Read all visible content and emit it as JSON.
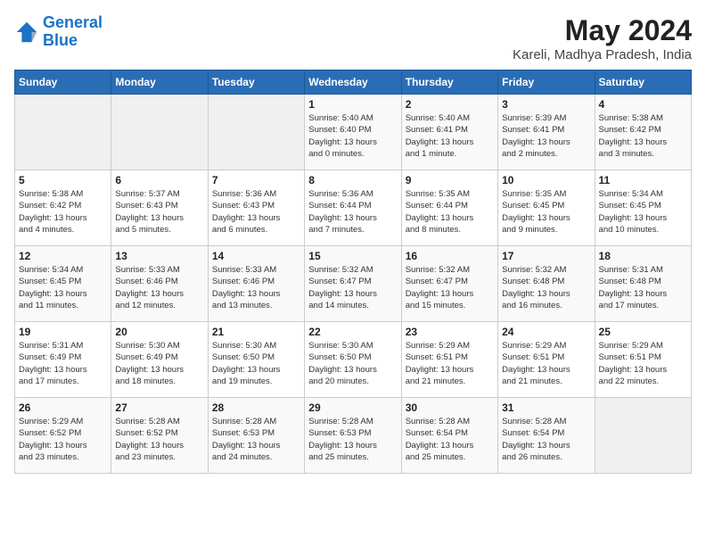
{
  "header": {
    "logo_line1": "General",
    "logo_line2": "Blue",
    "month_year": "May 2024",
    "location": "Kareli, Madhya Pradesh, India"
  },
  "days_of_week": [
    "Sunday",
    "Monday",
    "Tuesday",
    "Wednesday",
    "Thursday",
    "Friday",
    "Saturday"
  ],
  "weeks": [
    [
      {
        "day": "",
        "info": ""
      },
      {
        "day": "",
        "info": ""
      },
      {
        "day": "",
        "info": ""
      },
      {
        "day": "1",
        "info": "Sunrise: 5:40 AM\nSunset: 6:40 PM\nDaylight: 13 hours\nand 0 minutes."
      },
      {
        "day": "2",
        "info": "Sunrise: 5:40 AM\nSunset: 6:41 PM\nDaylight: 13 hours\nand 1 minute."
      },
      {
        "day": "3",
        "info": "Sunrise: 5:39 AM\nSunset: 6:41 PM\nDaylight: 13 hours\nand 2 minutes."
      },
      {
        "day": "4",
        "info": "Sunrise: 5:38 AM\nSunset: 6:42 PM\nDaylight: 13 hours\nand 3 minutes."
      }
    ],
    [
      {
        "day": "5",
        "info": "Sunrise: 5:38 AM\nSunset: 6:42 PM\nDaylight: 13 hours\nand 4 minutes."
      },
      {
        "day": "6",
        "info": "Sunrise: 5:37 AM\nSunset: 6:43 PM\nDaylight: 13 hours\nand 5 minutes."
      },
      {
        "day": "7",
        "info": "Sunrise: 5:36 AM\nSunset: 6:43 PM\nDaylight: 13 hours\nand 6 minutes."
      },
      {
        "day": "8",
        "info": "Sunrise: 5:36 AM\nSunset: 6:44 PM\nDaylight: 13 hours\nand 7 minutes."
      },
      {
        "day": "9",
        "info": "Sunrise: 5:35 AM\nSunset: 6:44 PM\nDaylight: 13 hours\nand 8 minutes."
      },
      {
        "day": "10",
        "info": "Sunrise: 5:35 AM\nSunset: 6:45 PM\nDaylight: 13 hours\nand 9 minutes."
      },
      {
        "day": "11",
        "info": "Sunrise: 5:34 AM\nSunset: 6:45 PM\nDaylight: 13 hours\nand 10 minutes."
      }
    ],
    [
      {
        "day": "12",
        "info": "Sunrise: 5:34 AM\nSunset: 6:45 PM\nDaylight: 13 hours\nand 11 minutes."
      },
      {
        "day": "13",
        "info": "Sunrise: 5:33 AM\nSunset: 6:46 PM\nDaylight: 13 hours\nand 12 minutes."
      },
      {
        "day": "14",
        "info": "Sunrise: 5:33 AM\nSunset: 6:46 PM\nDaylight: 13 hours\nand 13 minutes."
      },
      {
        "day": "15",
        "info": "Sunrise: 5:32 AM\nSunset: 6:47 PM\nDaylight: 13 hours\nand 14 minutes."
      },
      {
        "day": "16",
        "info": "Sunrise: 5:32 AM\nSunset: 6:47 PM\nDaylight: 13 hours\nand 15 minutes."
      },
      {
        "day": "17",
        "info": "Sunrise: 5:32 AM\nSunset: 6:48 PM\nDaylight: 13 hours\nand 16 minutes."
      },
      {
        "day": "18",
        "info": "Sunrise: 5:31 AM\nSunset: 6:48 PM\nDaylight: 13 hours\nand 17 minutes."
      }
    ],
    [
      {
        "day": "19",
        "info": "Sunrise: 5:31 AM\nSunset: 6:49 PM\nDaylight: 13 hours\nand 17 minutes."
      },
      {
        "day": "20",
        "info": "Sunrise: 5:30 AM\nSunset: 6:49 PM\nDaylight: 13 hours\nand 18 minutes."
      },
      {
        "day": "21",
        "info": "Sunrise: 5:30 AM\nSunset: 6:50 PM\nDaylight: 13 hours\nand 19 minutes."
      },
      {
        "day": "22",
        "info": "Sunrise: 5:30 AM\nSunset: 6:50 PM\nDaylight: 13 hours\nand 20 minutes."
      },
      {
        "day": "23",
        "info": "Sunrise: 5:29 AM\nSunset: 6:51 PM\nDaylight: 13 hours\nand 21 minutes."
      },
      {
        "day": "24",
        "info": "Sunrise: 5:29 AM\nSunset: 6:51 PM\nDaylight: 13 hours\nand 21 minutes."
      },
      {
        "day": "25",
        "info": "Sunrise: 5:29 AM\nSunset: 6:51 PM\nDaylight: 13 hours\nand 22 minutes."
      }
    ],
    [
      {
        "day": "26",
        "info": "Sunrise: 5:29 AM\nSunset: 6:52 PM\nDaylight: 13 hours\nand 23 minutes."
      },
      {
        "day": "27",
        "info": "Sunrise: 5:28 AM\nSunset: 6:52 PM\nDaylight: 13 hours\nand 23 minutes."
      },
      {
        "day": "28",
        "info": "Sunrise: 5:28 AM\nSunset: 6:53 PM\nDaylight: 13 hours\nand 24 minutes."
      },
      {
        "day": "29",
        "info": "Sunrise: 5:28 AM\nSunset: 6:53 PM\nDaylight: 13 hours\nand 25 minutes."
      },
      {
        "day": "30",
        "info": "Sunrise: 5:28 AM\nSunset: 6:54 PM\nDaylight: 13 hours\nand 25 minutes."
      },
      {
        "day": "31",
        "info": "Sunrise: 5:28 AM\nSunset: 6:54 PM\nDaylight: 13 hours\nand 26 minutes."
      },
      {
        "day": "",
        "info": ""
      }
    ]
  ]
}
